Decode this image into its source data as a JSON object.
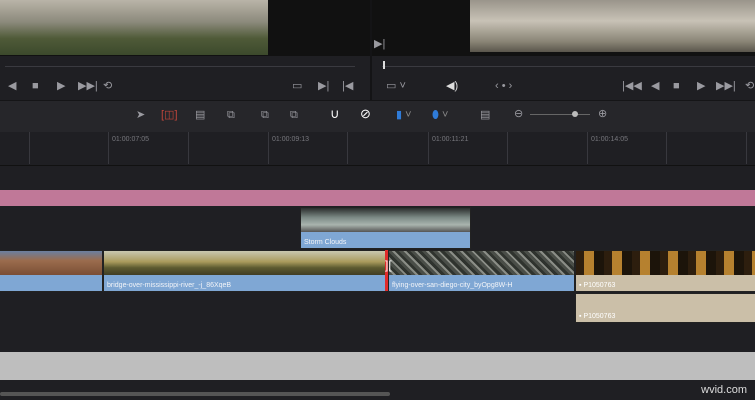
{
  "viewers": {
    "source_image": "source-viewer-frame",
    "timeline_image": "timeline-viewer-frame"
  },
  "transport_left": [
    "prev-frame-icon",
    "stop-icon",
    "play-icon",
    "next-clip-icon",
    "loop-icon",
    "match-frame-icon",
    "mark-out-icon",
    "mark-in-icon"
  ],
  "transport_right": [
    "viewer-size-icon",
    "volume-icon",
    "jog-icon",
    "first-frame-icon",
    "prev-frame-icon",
    "stop-icon",
    "play-icon",
    "next-clip-icon",
    "loop-icon"
  ],
  "toolbar": [
    "selection-tool-icon",
    "trim-edit-icon",
    "blade-icon",
    "insert-clip-icon",
    "overwrite-clip-icon",
    "replace-clip-icon",
    "snapping-icon",
    "linked-selection-icon",
    "flag-icon",
    "marker-icon",
    "timeline-view-icon",
    "zoom-out-icon",
    "zoom-in-icon"
  ],
  "zoom_level": 0.75,
  "ruler": [
    "01:00:07:05",
    "01:00:09:13",
    "01:00:11:21",
    "01:00:14:05"
  ],
  "clips": {
    "storm": "Storm Clouds",
    "bridge": "bridge-over-mississippi-river_-j_86XqeB",
    "flying": "flying-over-san-diego-city_byOpg8W-H",
    "video_p": "P1050763",
    "audio_p": "P1050763"
  },
  "colors": {
    "clip": "#7fa7d4",
    "title_track": "#c07898",
    "audio": "#cbbfa8",
    "playhead": "#e02b2b"
  },
  "watermark": "wvid.com"
}
